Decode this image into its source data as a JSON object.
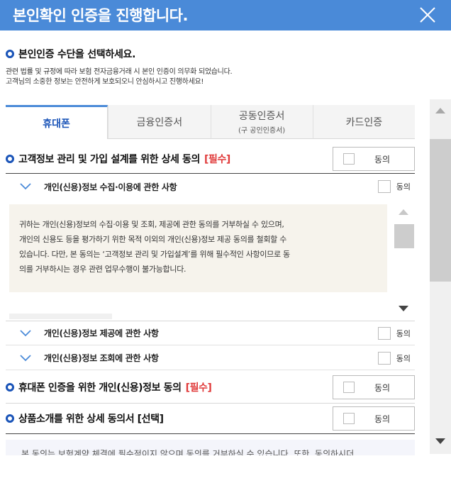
{
  "header": {
    "title": "본인확인 인증을 진행합니다."
  },
  "section": {
    "title": "본인인증 수단을 선택하세요.",
    "desc_line1": "관련 법률 및 규정에 따라 보험 전자금융거래 시 본인 인증이 의무화 되었습니다.",
    "desc_line2": "고객님의 소중한 정보는 안전하게 보호되오니 안심하시고 진행하세요!"
  },
  "tabs": [
    {
      "label": "휴대폰",
      "sub": ""
    },
    {
      "label": "금융인증서",
      "sub": ""
    },
    {
      "label": "공동인증서",
      "sub": "(구 공인인증서)"
    },
    {
      "label": "카드인증",
      "sub": ""
    }
  ],
  "consent1": {
    "title": "고객정보 관리 및 가입 설계를 위한 상세 동의",
    "tag": "[필수]",
    "agree_label": "동의",
    "items": [
      {
        "label": "개인(신용)정보 수집·이용에 관한 사항",
        "agree_label": "동의"
      },
      {
        "label": "개인(신용)정보 제공에 관한 사항",
        "agree_label": "동의"
      },
      {
        "label": "개인(신용)정보 조회에 관한 사항",
        "agree_label": "동의"
      }
    ],
    "content": {
      "line1": "귀하는 개인(신용)정보의 수집·이용 및 조회, 제공에 관한 동의를 거부하실 수 있으며,",
      "line2": "개인의 신용도 등을 평가하기 위한 목적 이외의 개인(신용)정보 제공 동의를 철회할 수",
      "line3": "있습니다. 다만, 본 동의는 ‘고객정보 관리 및 가입설계’를 위해 필수적인 사항이므로 동",
      "line4": "의를 거부하시는 경우 관련 업무수행이 불가능합니다."
    }
  },
  "consent2": {
    "title": "휴대폰 인증을 위한 개인(신용)정보 동의",
    "tag": "[필수]",
    "agree_label": "동의"
  },
  "consent3": {
    "title": "상품소개를 위한 상세 동의서 [선택]",
    "agree_label": "동의"
  },
  "bottom_text": "본 동의는 보험계약 체결에 필수적이지 않으며 동의를 거부하실 수 있습니다. 또한, 동의하시더",
  "colors": {
    "header_bg": "#4a8ad8",
    "accent": "#1a54b8",
    "required": "#e03a3a"
  }
}
